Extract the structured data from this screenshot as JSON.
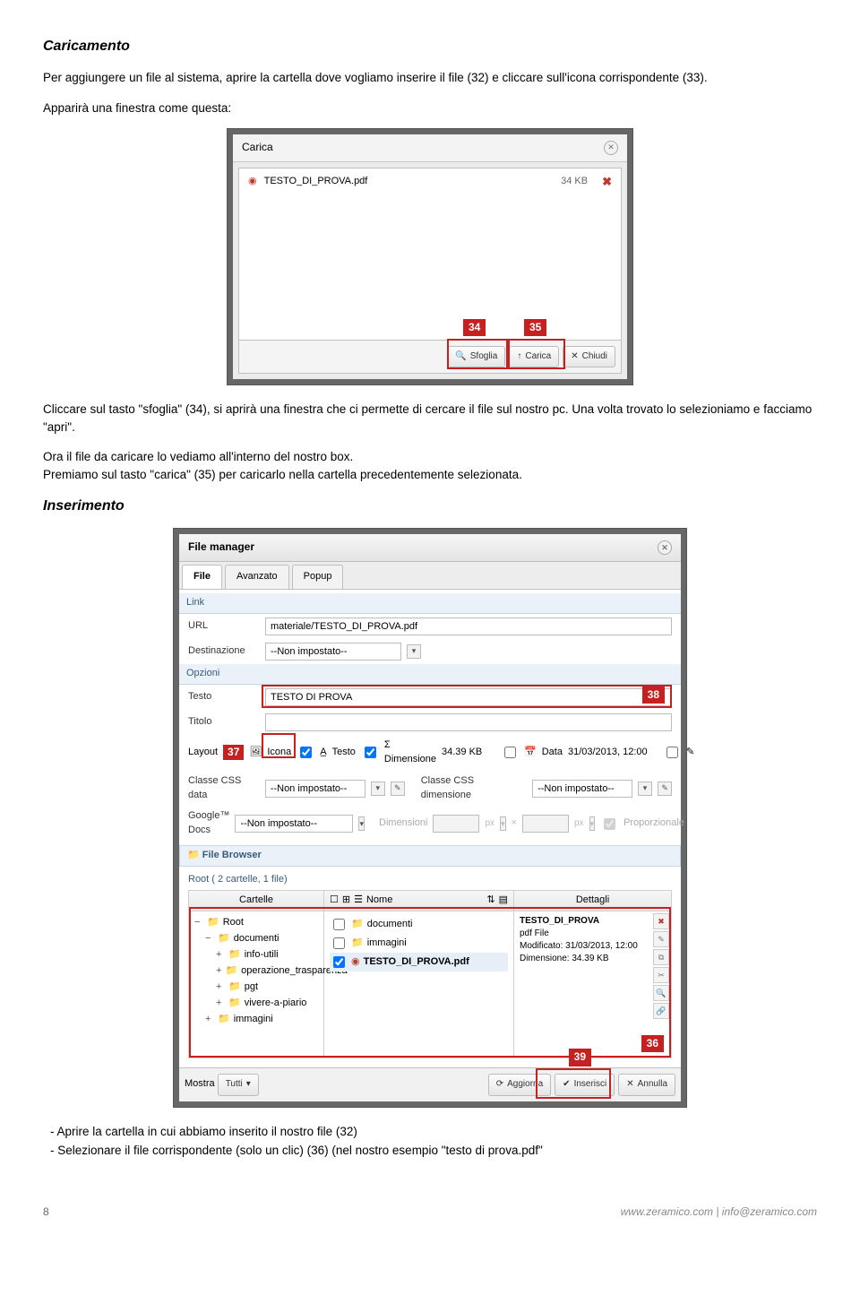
{
  "headings": {
    "caricamento": "Caricamento",
    "inserimento": "Inserimento"
  },
  "para1": "Per aggiungere un file al sistema, aprire la cartella dove vogliamo inserire il file (32) e cliccare sull'icona corrispondente (33).",
  "para2": "Apparirà una finestra come questa:",
  "carica": {
    "title": "Carica",
    "file_name": "TESTO_DI_PROVA.pdf",
    "file_size": "34 KB",
    "btn_sfoglia": "Sfoglia",
    "btn_carica": "Carica",
    "btn_chiudi": "Chiudi",
    "label34": "34",
    "label35": "35"
  },
  "para3a": "Cliccare sul tasto \"sfoglia\" (34), si aprirà una finestra che ci permette di cercare il file sul nostro pc. Una volta trovato lo selezioniamo e facciamo \"apri\".",
  "para3b": "Ora il file da caricare lo vediamo all'interno del nostro box.",
  "para3c": "Premiamo sul tasto \"carica\" (35) per caricarlo nella cartella precedentemente selezionata.",
  "fm": {
    "dialog_title": "File manager",
    "tabs": {
      "file": "File",
      "avanzato": "Avanzato",
      "popup": "Popup"
    },
    "link_section": "Link",
    "labels": {
      "url": "URL",
      "dest": "Destinazione",
      "opzioni": "Opzioni",
      "testo": "Testo",
      "titolo": "Titolo",
      "layout": "Layout",
      "icona": "Icona",
      "ae_testo": "Testo",
      "dim": "Σ Dimensione",
      "data": "Data",
      "css_data": "Classe CSS data",
      "css_dim": "Classe CSS dimensione",
      "gdocs": "Google™ Docs",
      "prop": "Proporzionale",
      "dims_lbl": "Dimensioni"
    },
    "values": {
      "url": "materiale/TESTO_DI_PROVA.pdf",
      "dest": "--Non impostato--",
      "testo": "TESTO DI PROVA",
      "titolo": "",
      "dim": "34.39 KB",
      "data": "31/03/2013, 12:00",
      "css_data": "--Non impostato--",
      "css_dim": "--Non impostato--",
      "gdocs": "--Non impostato--",
      "px": "px"
    },
    "browser_label": "File Browser",
    "root_line": "Root   ( 2 cartelle, 1 file)",
    "col_cartelle": "Cartelle",
    "col_nome": "Nome",
    "col_dettagli": "Dettagli",
    "tree": {
      "root": "Root",
      "documenti": "documenti",
      "info": "info-utili",
      "op_trasp": "operazione_trasparenza",
      "pgt": "pgt",
      "vivere": "vivere-a-piario",
      "immagini": "immagini"
    },
    "files": {
      "documenti": "documenti",
      "immagini": "immagini",
      "pdf": "TESTO_DI_PROVA.pdf"
    },
    "details": {
      "name": "TESTO_DI_PROVA",
      "type": "pdf File",
      "mod": "Modificato: 31/03/2013, 12:00",
      "dim": "Dimensione: 34.39 KB"
    },
    "footer": {
      "mostra": "Mostra",
      "tutti": "Tutti",
      "aggiorna": "Aggiorna",
      "inserisci": "Inserisci",
      "annulla": "Annulla"
    },
    "labels_red": {
      "l36": "36",
      "l37": "37",
      "l38": "38",
      "l39": "39"
    }
  },
  "bullet1": "-    Aprire la cartella in cui abbiamo inserito il nostro file  (32)",
  "bullet2": "-    Selezionare il file corrispondente (solo un clic) (36) (nel nostro esempio \"testo di prova.pdf\"",
  "footer": {
    "page": "8",
    "url": "www.zeramico.com | info@zeramico.com"
  }
}
